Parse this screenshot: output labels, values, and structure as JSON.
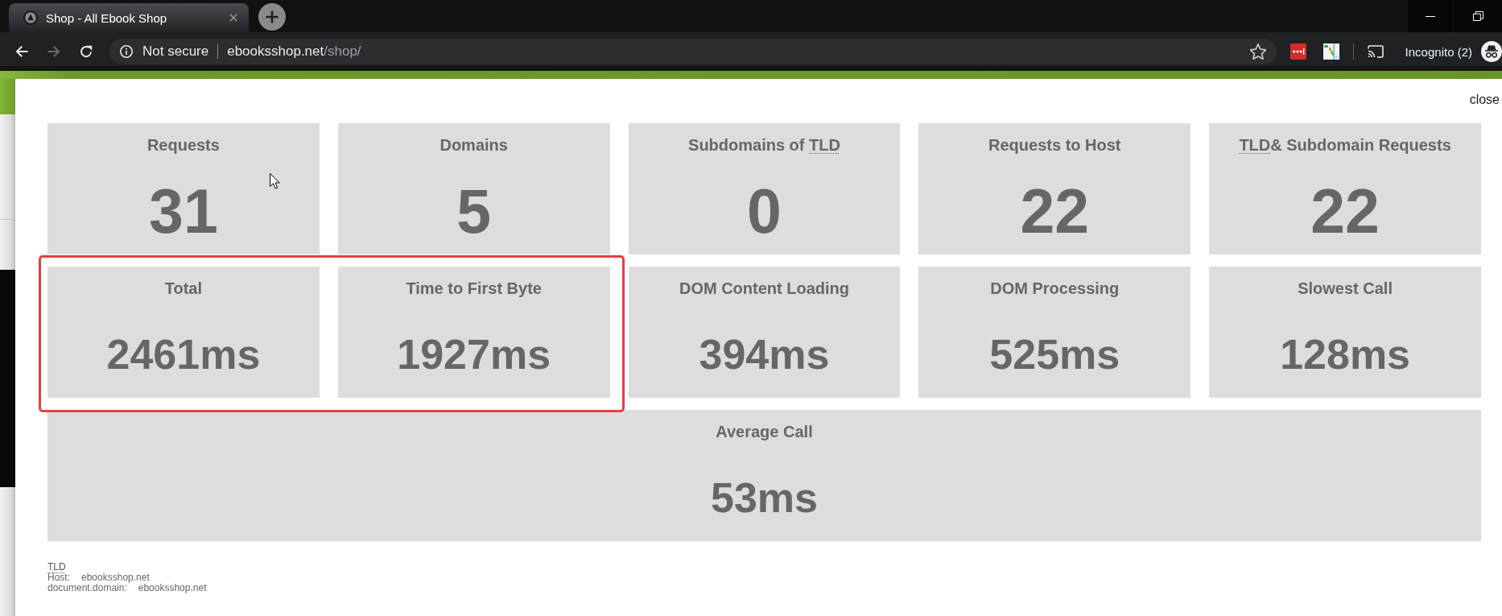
{
  "browser": {
    "tabs": [
      {
        "title": "Shop - All Ebook Shop",
        "selected": true
      }
    ],
    "nav_buttons": [
      {
        "kind": "back",
        "disabled": false
      },
      {
        "kind": "forward",
        "disabled": true
      },
      {
        "kind": "reload",
        "disabled": false
      }
    ],
    "address_bar": {
      "security": "Not secure",
      "host": "ebooksshop.net",
      "path": "/shop/"
    },
    "profile": "Incognito (2)"
  },
  "modal": {
    "close": "close",
    "rows": [
      {
        "kind": "count",
        "cards": [
          {
            "title": [
              {
                "kind": "plain",
                "text": "Requests"
              }
            ],
            "value": "31",
            "highlighted": false
          },
          {
            "title": [
              {
                "kind": "plain",
                "text": "Domains"
              }
            ],
            "value": "5",
            "highlighted": false
          },
          {
            "title": [
              {
                "kind": "plain",
                "text": "Subdomains of "
              },
              {
                "kind": "abbr",
                "text": "TLD"
              }
            ],
            "value": "0",
            "highlighted": false
          },
          {
            "title": [
              {
                "kind": "plain",
                "text": "Requests to Host"
              }
            ],
            "value": "22",
            "highlighted": false
          },
          {
            "title": [
              {
                "kind": "abbr",
                "text": "TLD"
              },
              {
                "kind": "plain",
                "text": "& Subdomain Requests"
              }
            ],
            "value": "22",
            "highlighted": false
          }
        ]
      },
      {
        "kind": "timing",
        "cards": [
          {
            "title": [
              {
                "kind": "plain",
                "text": "Total"
              }
            ],
            "value": "2461ms",
            "highlighted": true
          },
          {
            "title": [
              {
                "kind": "plain",
                "text": "Time to First Byte"
              }
            ],
            "value": "1927ms",
            "highlighted": true
          },
          {
            "title": [
              {
                "kind": "plain",
                "text": "DOM Content Loading"
              }
            ],
            "value": "394ms",
            "highlighted": false
          },
          {
            "title": [
              {
                "kind": "plain",
                "text": "DOM Processing"
              }
            ],
            "value": "525ms",
            "highlighted": false
          },
          {
            "title": [
              {
                "kind": "plain",
                "text": "Slowest Call"
              }
            ],
            "value": "128ms",
            "highlighted": false
          }
        ]
      },
      {
        "kind": "summary",
        "cards": [
          {
            "title": [
              {
                "kind": "plain",
                "text": "Average Call"
              }
            ],
            "value": "53ms",
            "highlighted": false
          }
        ]
      }
    ],
    "footer": {
      "abbr": "TLD",
      "lines": [
        {
          "label": "Host:",
          "value": "ebooksshop.net"
        },
        {
          "label": "document.domain:",
          "value": "ebooksshop.net"
        }
      ]
    }
  }
}
